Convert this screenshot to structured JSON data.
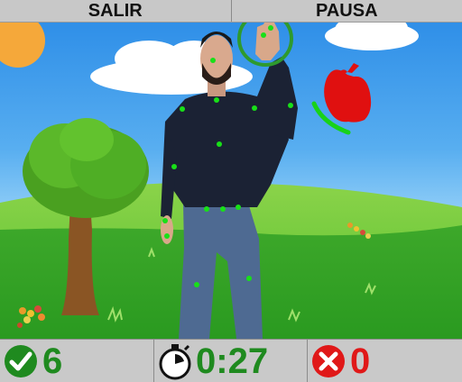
{
  "topbar": {
    "exit_label": "SALIR",
    "pause_label": "PAUSA"
  },
  "scene": {
    "target_icon": "apple-icon",
    "hand_target_icon": "hand-target-ring-icon",
    "colors": {
      "sky": "#4aa3ef",
      "grass": "#3fb02a",
      "apple": "#e01010",
      "ring": "#2e9a2e",
      "tracking_point": "#18e018"
    }
  },
  "stats": {
    "hits": {
      "icon": "check-circle-icon",
      "value": "6"
    },
    "timer": {
      "icon": "stopwatch-icon",
      "value": "0:27"
    },
    "misses": {
      "icon": "x-circle-icon",
      "value": "0"
    }
  }
}
